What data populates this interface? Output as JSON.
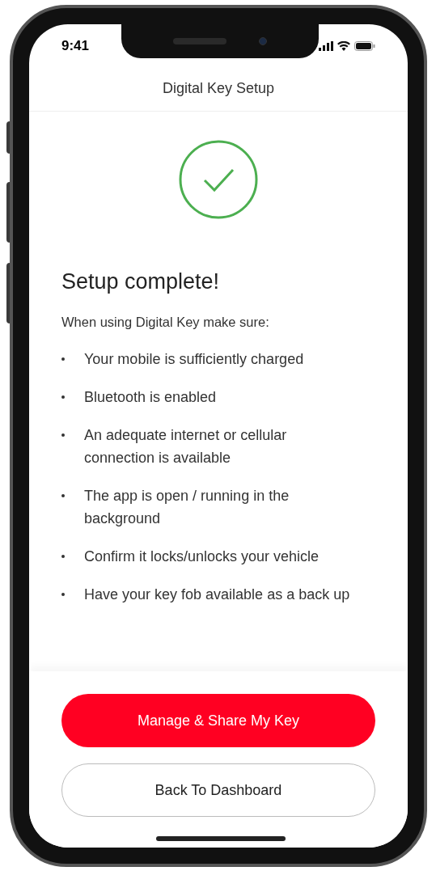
{
  "status_bar": {
    "time": "9:41"
  },
  "header": {
    "title": "Digital Key Setup"
  },
  "success": {
    "title": "Setup complete!",
    "intro": "When using Digital Key make sure:"
  },
  "checklist": [
    {
      "text": "Your mobile is sufficiently charged"
    },
    {
      "text": "Bluetooth is enabled"
    },
    {
      "text": "An adequate internet or cellular connection is available"
    },
    {
      "text": "The app is open / running in the background"
    },
    {
      "text": "Confirm it locks/unlocks your vehicle"
    },
    {
      "text": "Have your key fob available as a back up"
    }
  ],
  "buttons": [
    {
      "label": "Manage & Share My Key",
      "kind": "primary"
    },
    {
      "label": "Back To Dashboard",
      "kind": "secondary"
    }
  ]
}
